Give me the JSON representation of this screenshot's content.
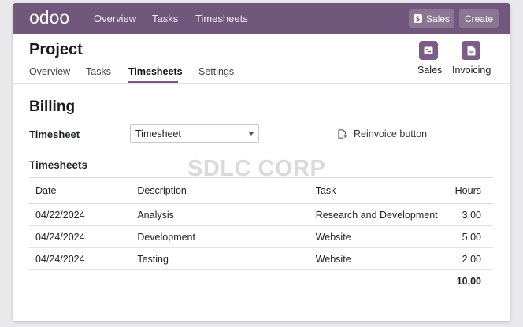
{
  "topbar": {
    "logo": "odoo",
    "nav": [
      "Overview",
      "Tasks",
      "Timesheets"
    ],
    "sales_button": "Sales",
    "create_button": "Create"
  },
  "project": {
    "title": "Project",
    "tabs": [
      "Overview",
      "Tasks",
      "Timesheets",
      "Settings"
    ],
    "active_tab": "Timesheets",
    "apps": [
      {
        "label": "Sales",
        "icon": "sales-app-icon"
      },
      {
        "label": "Invoicing",
        "icon": "invoicing-app-icon"
      }
    ]
  },
  "billing": {
    "title": "Billing",
    "field_label": "Timesheet",
    "field_value": "Timesheet",
    "reinvoice_label": "Reinvoice button"
  },
  "timesheets": {
    "title": "Timesheets",
    "columns": [
      "Date",
      "Description",
      "Task",
      "Hours"
    ],
    "rows": [
      {
        "date": "04/22/2024",
        "description": "Analysis",
        "task": "Research and Development",
        "hours": "3,00"
      },
      {
        "date": "04/24/2024",
        "description": "Development",
        "task": "Website",
        "hours": "5,00"
      },
      {
        "date": "04/24/2024",
        "description": "Testing",
        "task": "Website",
        "hours": "2,00"
      }
    ],
    "total_hours": "10,00"
  },
  "watermark": "SDLC CORP",
  "colors": {
    "brand": "#71577b",
    "tile": "#7c5c88"
  }
}
